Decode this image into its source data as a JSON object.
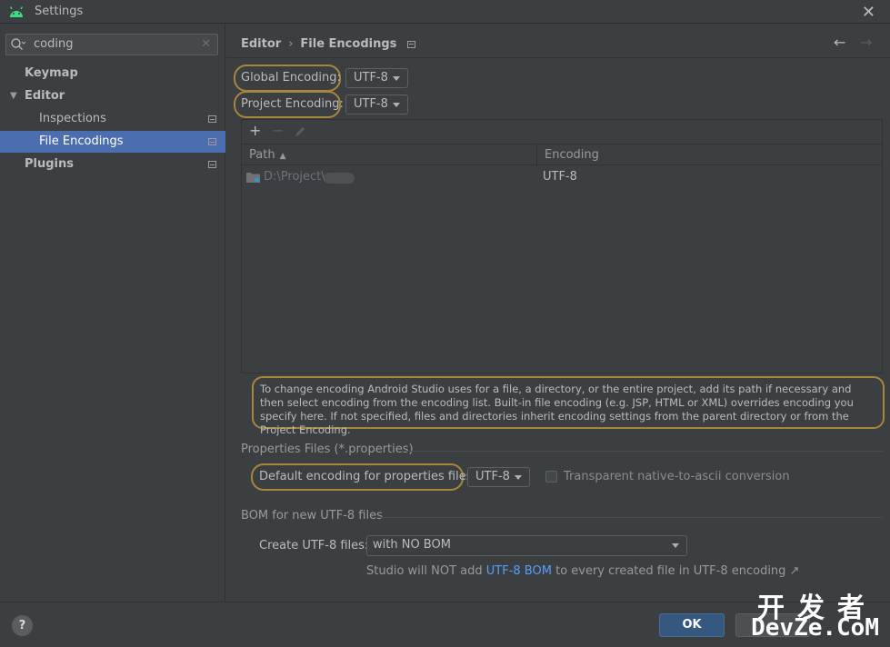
{
  "window": {
    "title": "Settings"
  },
  "sidebar": {
    "search_value": "coding",
    "items": [
      {
        "label": "Keymap"
      },
      {
        "label": "Editor"
      },
      {
        "label": "Inspections"
      },
      {
        "label": "File Encodings"
      },
      {
        "label": "Plugins"
      }
    ]
  },
  "breadcrumb": {
    "parent": "Editor",
    "separator": "›",
    "current": "File Encodings"
  },
  "encoding": {
    "global_label": "Global Encoding:",
    "global_value": "UTF-8",
    "project_label": "Project Encoding:",
    "project_value": "UTF-8"
  },
  "table": {
    "toolbar": {
      "add": "+",
      "remove": "−"
    },
    "col_path": "Path",
    "col_encoding": "Encoding",
    "rows": [
      {
        "path": "D:\\Project\\",
        "encoding": "UTF-8"
      }
    ]
  },
  "note": "To change encoding Android Studio uses for a file, a directory, or the entire project, add its path if necessary and then select encoding from the encoding list. Built-in file encoding (e.g. JSP, HTML or XML) overrides encoding you specify here. If not specified, files and directories inherit encoding settings from the parent directory or from the Project Encoding.",
  "properties": {
    "section": "Properties Files (*.properties)",
    "default_label": "Default encoding for properties files:",
    "default_value": "UTF-8",
    "transparent_label": "Transparent native-to-ascii conversion"
  },
  "bom": {
    "section": "BOM for new UTF-8 files",
    "create_label": "Create UTF-8 files:",
    "create_value": "with NO BOM",
    "info_prefix": "Studio will NOT add",
    "info_link": "UTF-8 BOM",
    "info_suffix": "to every created file in UTF-8 encoding ↗"
  },
  "footer": {
    "help": "?",
    "ok": "OK"
  },
  "watermark": {
    "cn": "开发者",
    "en": "DevZe.CoM"
  },
  "colors": {
    "accent": "#4b6eaf",
    "highlight": "#a8853c",
    "ok_button": "#365880",
    "link": "#589df6"
  }
}
